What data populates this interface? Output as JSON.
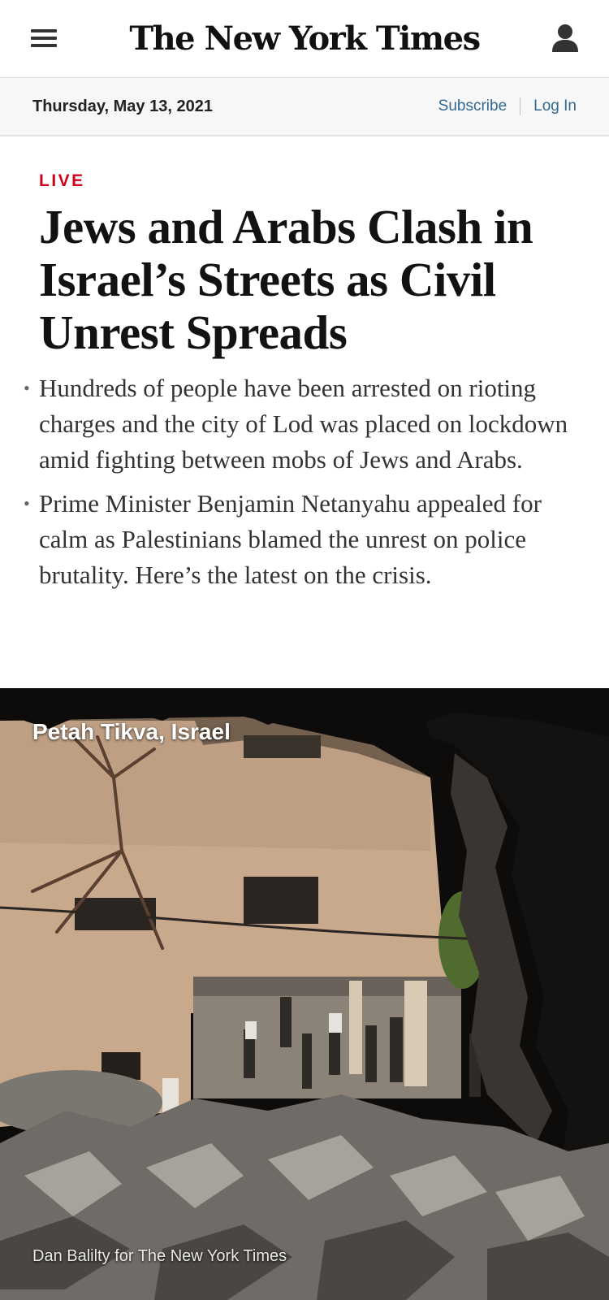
{
  "header": {
    "logo": "The New York Times",
    "menu_icon": "hamburger-menu-icon",
    "account_icon": "person-icon"
  },
  "datebar": {
    "date": "Thursday, May 13, 2021",
    "subscribe": "Subscribe",
    "login": "Log In"
  },
  "article": {
    "label": "LIVE",
    "headline": "Jews and Arabs Clash in Israel’s Streets as Civil Unrest Spreads",
    "bullets": [
      "Hundreds of people have been arrested on rioting charges and the city of Lod was placed on lockdown amid fighting between mobs of Jews and Arabs.",
      "Prime Minister Benjamin Netanyahu appealed for calm as Palestinians blamed the unrest on police brutality. Here’s the latest on the crisis."
    ]
  },
  "photo": {
    "location": "Petah Tikva, Israel",
    "credit": "Dan Balilty for The New York Times"
  },
  "colors": {
    "live_red": "#d0021b",
    "link_blue": "#326891",
    "datebar_bg": "#f7f7f7"
  }
}
